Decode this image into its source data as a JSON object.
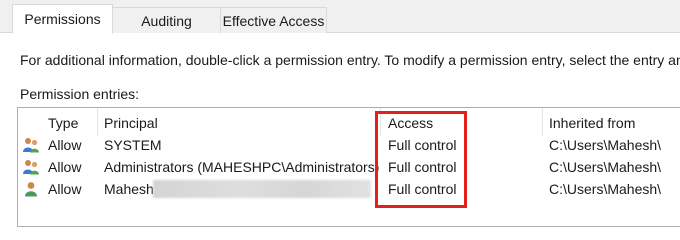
{
  "tabs": [
    {
      "label": "Permissions",
      "active": true
    },
    {
      "label": "Auditing",
      "active": false
    },
    {
      "label": "Effective Access",
      "active": false
    }
  ],
  "info_text": "For additional information, double-click a permission entry. To modify a permission entry, select the entry and c",
  "entries_label": "Permission entries:",
  "columns": [
    "Type",
    "Principal",
    "Access",
    "Inherited from"
  ],
  "rows": [
    {
      "icon": "users-group-icon",
      "type": "Allow",
      "principal": "SYSTEM",
      "access": "Full control",
      "inherited": "C:\\Users\\Mahesh\\"
    },
    {
      "icon": "users-group-icon",
      "type": "Allow",
      "principal": "Administrators (MAHESHPC\\Administrators)",
      "access": "Full control",
      "inherited": "C:\\Users\\Mahesh\\"
    },
    {
      "icon": "user-icon",
      "type": "Allow",
      "principal": "Mahesh",
      "access": "Full control",
      "inherited": "C:\\Users\\Mahesh\\"
    }
  ],
  "colors": {
    "highlight": "#e3201b",
    "border": "#adadad"
  }
}
